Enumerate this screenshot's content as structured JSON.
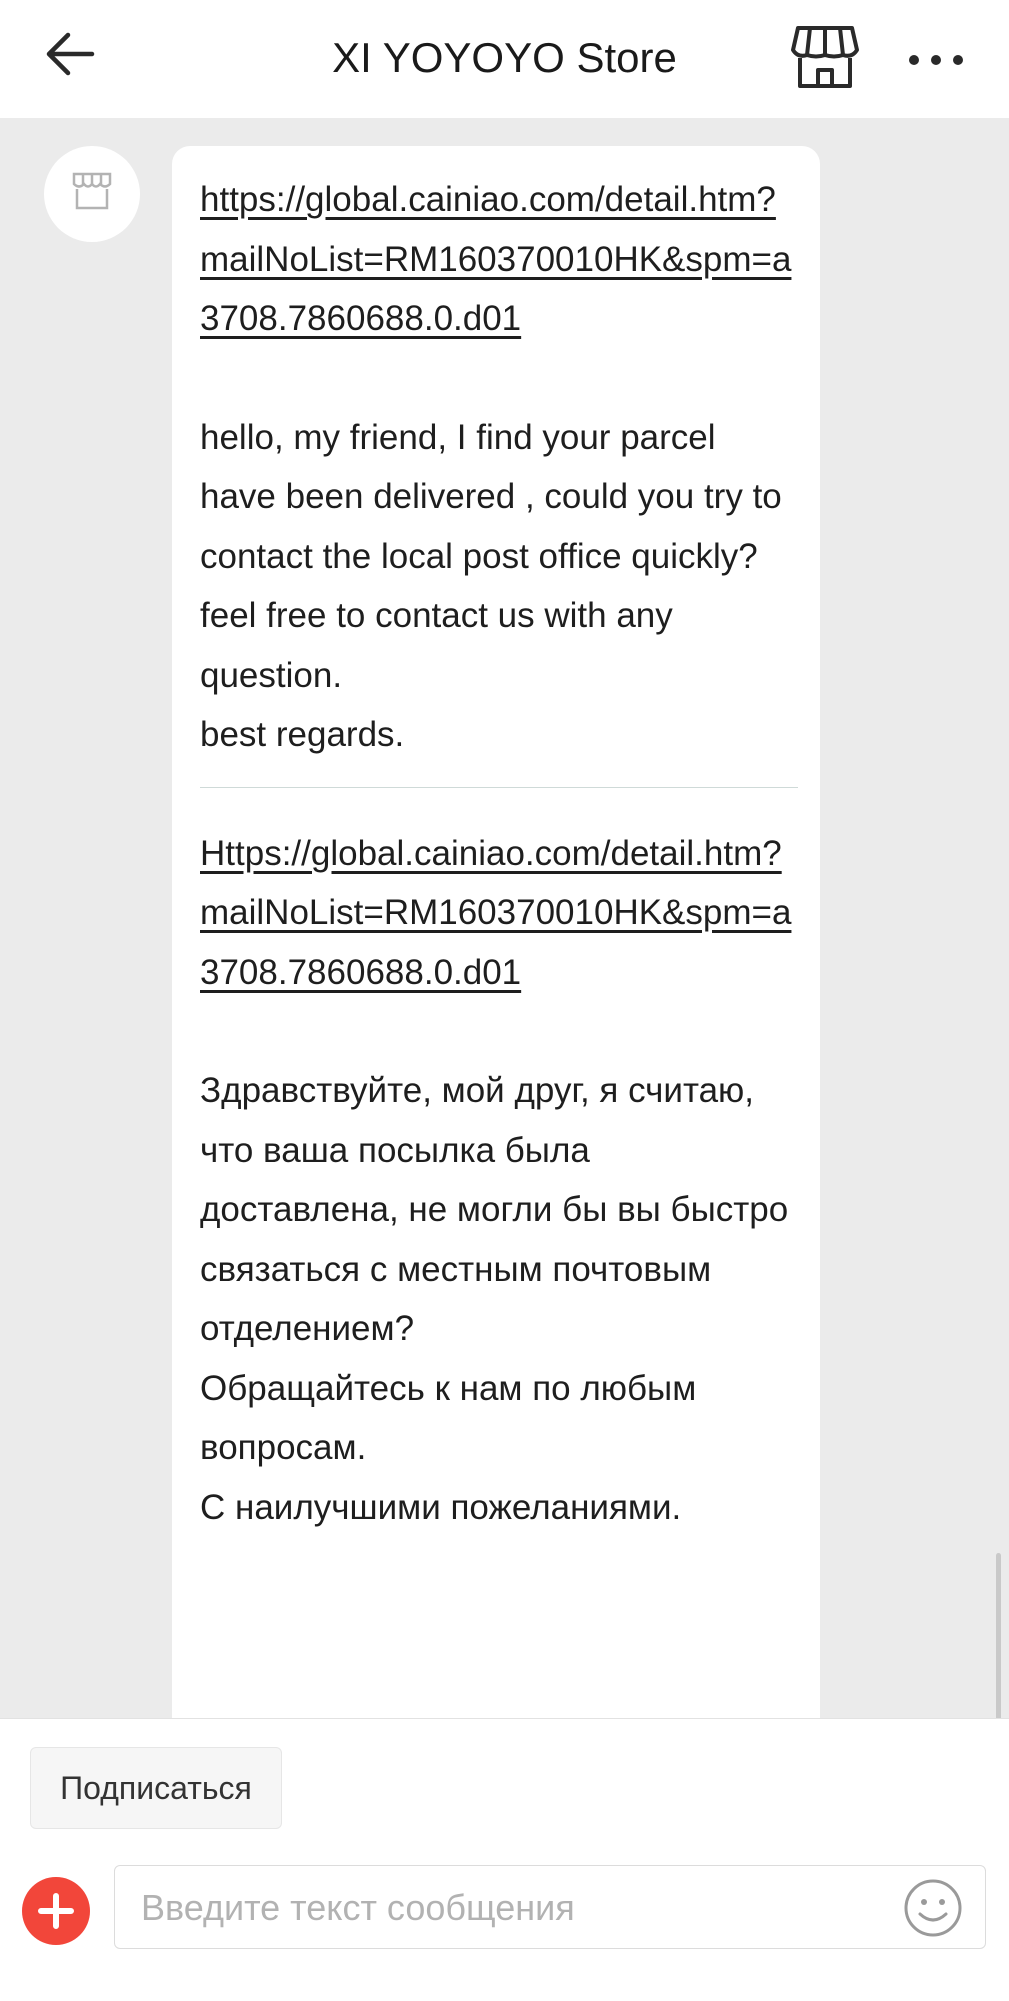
{
  "header": {
    "title": "XI YOYOYO Store",
    "icons": [
      "back-arrow-icon",
      "store-icon",
      "more-icon"
    ]
  },
  "chat": {
    "messages": [
      {
        "sender": "store",
        "link1": "https://global.cainiao.com/detail.htm?mailNoList=RM160370010HK&spm=a3708.7860688.0.d01",
        "text_en": "hello, my friend, I find your parcel have been delivered , could you try to contact the local post office quickly?\nfeel free to contact us with any question.\nbest regards.",
        "link2": "Https://global.cainiao.com/detail.htm?mailNoList=RM160370010HK&spm=a3708.7860688.0.d01",
        "text_ru": "Здравствуйте, мой друг, я считаю, что ваша посылка была доставлена, не могли бы вы быстро связаться с местным почтовым отделением?\nОбращайтесь к нам по любым вопросам.\nС наилучшими пожеланиями."
      }
    ]
  },
  "bottom": {
    "subscribe_label": "Подписаться",
    "input_placeholder": "Введите текст сообщения",
    "input_value": ""
  },
  "colors": {
    "accent_red": "#f2463a",
    "chat_background": "#ebebeb",
    "bubble_background": "#ffffff"
  }
}
